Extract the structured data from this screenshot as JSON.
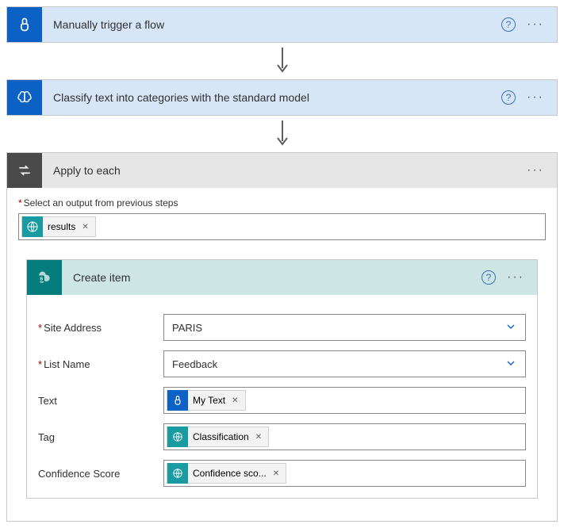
{
  "step1": {
    "title": "Manually trigger a flow"
  },
  "step2": {
    "title": "Classify text into categories with the standard model"
  },
  "applyEach": {
    "title": "Apply to each",
    "selectLabel": "Select an output from previous steps",
    "token": "results"
  },
  "createItem": {
    "title": "Create item",
    "fields": {
      "siteAddress": {
        "label": "Site Address",
        "value": "PARIS"
      },
      "listName": {
        "label": "List Name",
        "value": "Feedback"
      },
      "text": {
        "label": "Text",
        "token": "My Text"
      },
      "tag": {
        "label": "Tag",
        "token": "Classification"
      },
      "confidence": {
        "label": "Confidence Score",
        "token": "Confidence sco..."
      }
    }
  }
}
